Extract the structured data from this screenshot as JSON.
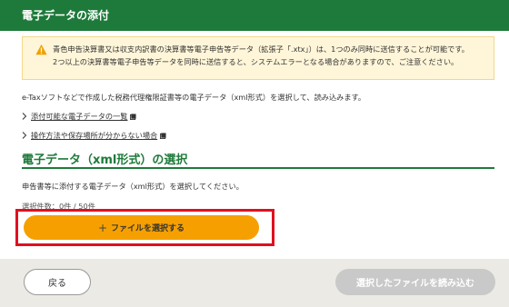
{
  "header": {
    "title": "電子データの添付"
  },
  "warning": {
    "icon": "warning-icon",
    "line1": "青色申告決算書又は収支内訳書の決算書等電子申告等データ（拡張子「.xtx」）は、1つのみ同時に送信することが可能です。",
    "line2": "2つ以上の決算書等電子申告等データを同時に送信すると、システムエラーとなる場合がありますので、ご注意ください。"
  },
  "intro": "e-Taxソフトなどで作成した税務代理権限証書等の電子データ（xml形式）を選択して、読み込みます。",
  "links": [
    {
      "label": "添付可能な電子データの一覧"
    },
    {
      "label": "操作方法や保存場所が分からない場合"
    }
  ],
  "section": {
    "title": "電子データ（xml形式）の選択",
    "instruction": "申告書等に添付する電子データ（xml形式）を選択してください。",
    "count": "選択件数：0件 / 50件"
  },
  "select_button": {
    "plus": "+",
    "label": "ファイルを選択する"
  },
  "footer": {
    "back_label": "戻る",
    "load_label": "選択したファイルを読み込む"
  },
  "colors": {
    "header_bg": "#1e7a3a",
    "accent_button": "#f5a000",
    "highlight_border": "#e0101f",
    "disabled_button": "#c9c9c9"
  }
}
